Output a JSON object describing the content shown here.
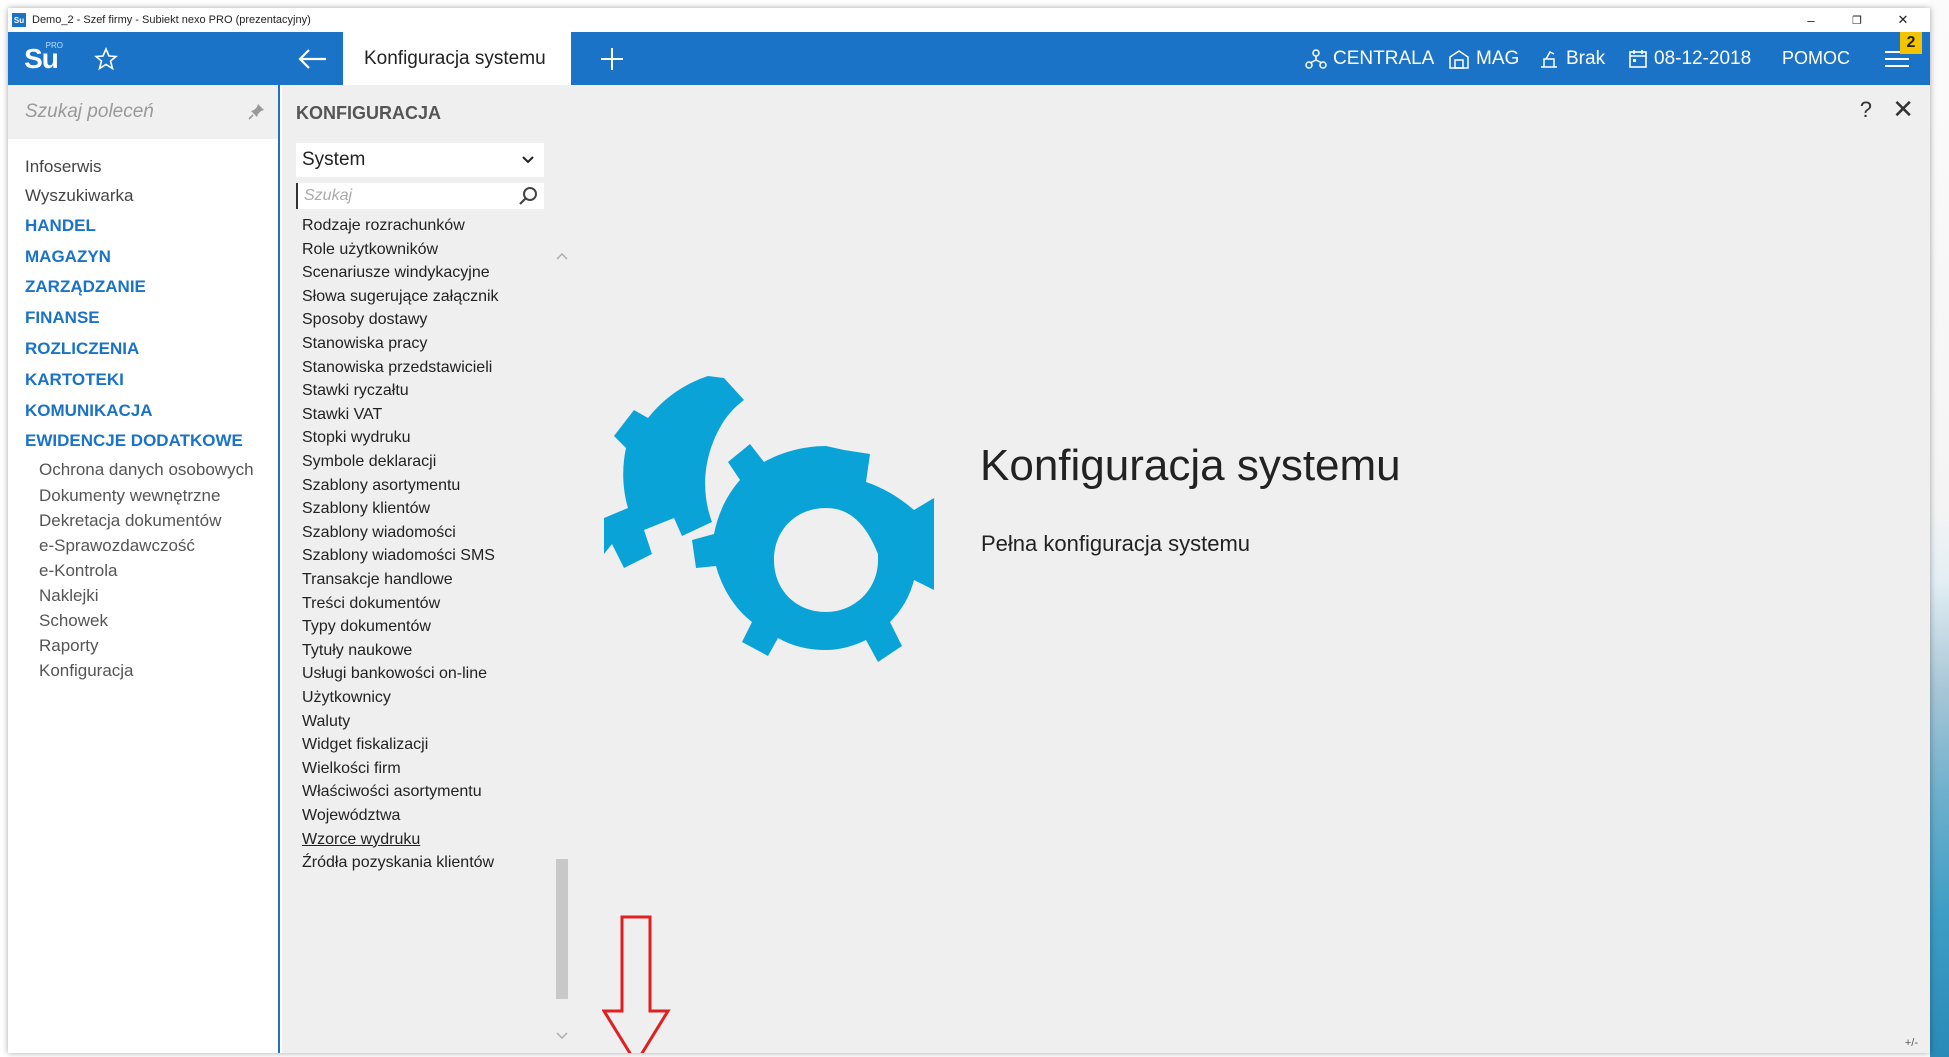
{
  "window": {
    "title": "Demo_2 - Szef firmy - Subiekt nexo PRO (prezentacyjny)",
    "icon_label": "Su",
    "controls": {
      "minimize": "–",
      "restore": "❐",
      "close": "✕"
    }
  },
  "topbar": {
    "logo": {
      "text": "Su",
      "sup": "PRO"
    },
    "active_tab": "Konfiguracja systemu",
    "items": [
      {
        "label": "CENTRALA",
        "icon": "network-icon"
      },
      {
        "label": "MAG",
        "icon": "warehouse-icon"
      },
      {
        "label": "Brak",
        "icon": "user-desk-icon"
      },
      {
        "label": "08-12-2018",
        "icon": "calendar-icon"
      },
      {
        "label": "POMOC",
        "icon": ""
      }
    ],
    "notification_count": "2",
    "accent_color": "#1a73c6"
  },
  "sidebar": {
    "search_placeholder": "Szukaj poleceń",
    "items": [
      {
        "label": "Infoserwis",
        "type": "plain"
      },
      {
        "label": "Wyszukiwarka",
        "type": "plain"
      },
      {
        "label": "HANDEL",
        "type": "section"
      },
      {
        "label": "MAGAZYN",
        "type": "section"
      },
      {
        "label": "ZARZĄDZANIE",
        "type": "section"
      },
      {
        "label": "FINANSE",
        "type": "section"
      },
      {
        "label": "ROZLICZENIA",
        "type": "section"
      },
      {
        "label": "KARTOTEKI",
        "type": "section"
      },
      {
        "label": "KOMUNIKACJA",
        "type": "section"
      },
      {
        "label": "EWIDENCJE DODATKOWE",
        "type": "section"
      }
    ],
    "subitems": [
      "Ochrona danych osobowych",
      "Dokumenty wewnętrzne",
      "Dekretacja dokumentów",
      "e-Sprawozdawczość",
      "e-Kontrola",
      "Naklejki",
      "Schowek",
      "Raporty",
      "Konfiguracja"
    ]
  },
  "content": {
    "header": "KONFIGURACJA",
    "help": "?",
    "close": "✕",
    "dropdown_value": "System",
    "search_placeholder": "Szukaj",
    "list": [
      "Rodzaje rozrachunków",
      "Role użytkowników",
      "Scenariusze windykacyjne",
      "Słowa sugerujące załącznik",
      "Sposoby dostawy",
      "Stanowiska pracy",
      "Stanowiska przedstawicieli",
      "Stawki ryczałtu",
      "Stawki VAT",
      "Stopki wydruku",
      "Symbole deklaracji",
      "Szablony asortymentu",
      "Szablony klientów",
      "Szablony wiadomości",
      "Szablony wiadomości SMS",
      "Transakcje handlowe",
      "Treści dokumentów",
      "Typy dokumentów",
      "Tytuły naukowe",
      "Usługi bankowości on-line",
      "Użytkownicy",
      "Waluty",
      "Widget fiskalizacji",
      "Wielkości firm",
      "Właściwości asortymentu",
      "Województwa",
      "Wzorce wydruku",
      "Źródła pozyskania klientów"
    ],
    "hovered_item": "Wzorce wydruku",
    "hero_title": "Konfiguracja systemu",
    "hero_subtitle": "Pełna konfiguracja systemu",
    "gear_color": "#0aa3d8",
    "annotation_color": "#e02020",
    "zoom_hint": "+/-"
  }
}
